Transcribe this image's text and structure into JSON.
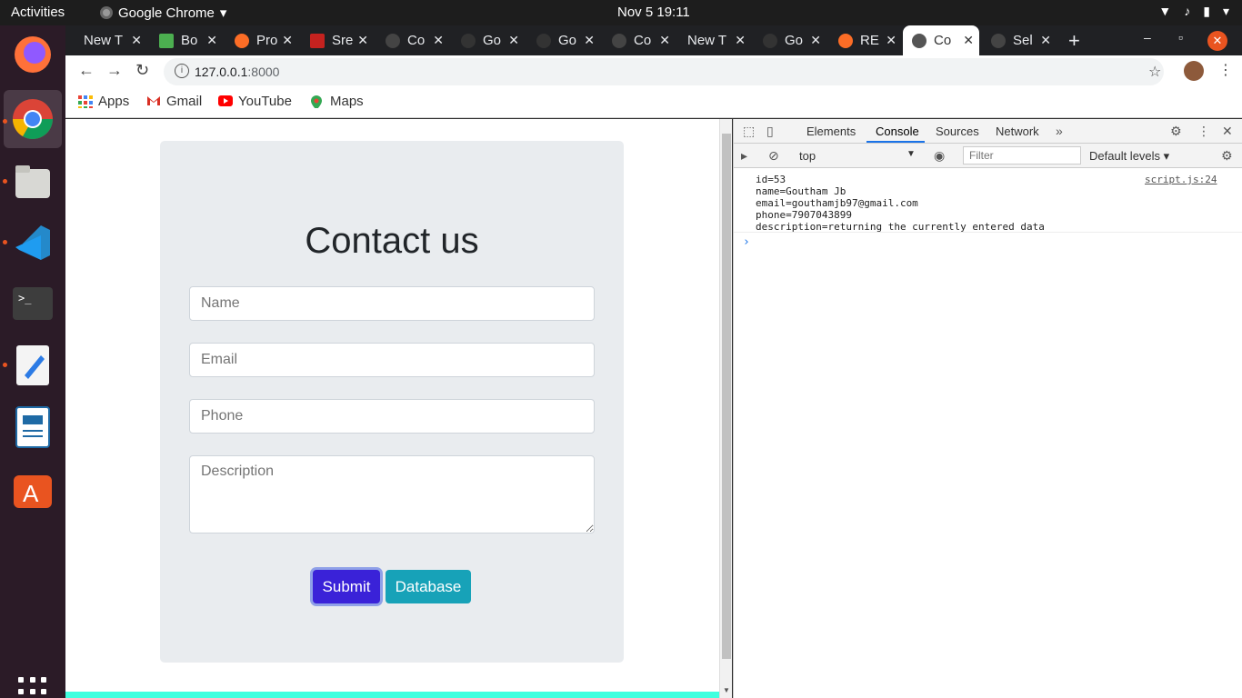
{
  "system": {
    "activities": "Activities",
    "app_name": "Google Chrome",
    "clock": "Nov 5  19:11"
  },
  "browser": {
    "tabs": [
      "New T",
      "Bo",
      "Pro",
      "Sre",
      "Co",
      "Go",
      "Go",
      "Co",
      "New T",
      "Go",
      "RE",
      "Co",
      "Sel"
    ],
    "active_tab_index": 11,
    "url_host": "127.0.0.1",
    "url_port": ":8000",
    "bookmarks": [
      "Apps",
      "Gmail",
      "YouTube",
      "Maps"
    ]
  },
  "page": {
    "heading": "Contact us",
    "name_placeholder": "Name",
    "email_placeholder": "Email",
    "phone_placeholder": "Phone",
    "description_placeholder": "Description",
    "submit_label": "Submit",
    "database_label": "Database"
  },
  "devtools": {
    "tabs": [
      "Elements",
      "Console",
      "Sources",
      "Network"
    ],
    "active_tab": "Console",
    "context": "top",
    "filter_placeholder": "Filter",
    "levels": "Default levels",
    "log_lines": "id=53\nname=Goutham Jb\nemail=gouthamjb97@gmail.com\nphone=7907043899\ndescription=returning the currently entered data",
    "log_source": "script.js:24",
    "prompt": "›"
  },
  "colors": {
    "submit_bg": "#3a22d8",
    "database_bg": "#17a2b8",
    "status_bar": "#40ffdf",
    "accent": "#1a73e8"
  }
}
